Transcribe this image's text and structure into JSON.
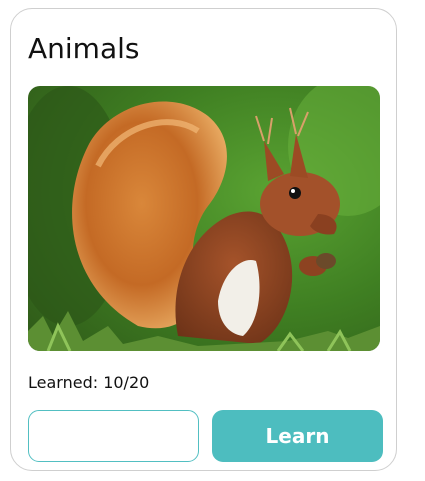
{
  "card": {
    "title": "Animals",
    "image_alt": "red squirrel",
    "progress_text": "Learned: 10/20",
    "answer_input": {
      "value": "",
      "placeholder": ""
    },
    "learn_button_label": "Learn"
  },
  "colors": {
    "accent": "#4dbdbf",
    "input_border": "#52bfc2",
    "card_border": "#cfcfcf",
    "text": "#111111"
  }
}
